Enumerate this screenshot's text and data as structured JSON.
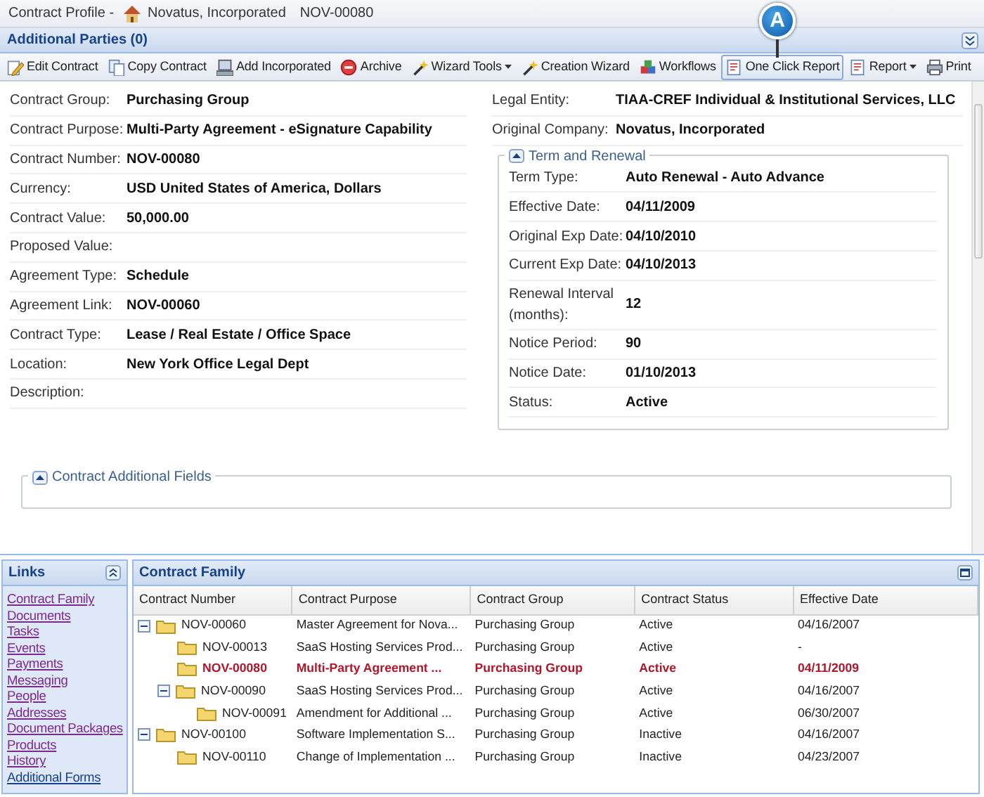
{
  "breadcrumb": {
    "prefix": "Contract Profile -",
    "company": "Novatus, Incorporated",
    "number": "NOV-00080"
  },
  "additional_parties": {
    "title": "Additional Parties (0)"
  },
  "callout": {
    "label": "A"
  },
  "toolbar": [
    {
      "label": "Edit Contract",
      "kind": "button",
      "pressed": false
    },
    {
      "label": "Copy Contract",
      "kind": "button",
      "pressed": false
    },
    {
      "label": "Add Incorporated",
      "kind": "button",
      "pressed": false
    },
    {
      "label": "Archive",
      "kind": "button",
      "pressed": false
    },
    {
      "label": "Wizard Tools",
      "kind": "dropdown",
      "pressed": false
    },
    {
      "label": "Creation Wizard",
      "kind": "button",
      "pressed": false
    },
    {
      "label": "Workflows",
      "kind": "button",
      "pressed": false
    },
    {
      "label": "One Click Report",
      "kind": "button",
      "pressed": true
    },
    {
      "label": "Report",
      "kind": "dropdown",
      "pressed": false
    },
    {
      "label": "Print",
      "kind": "button",
      "pressed": false
    }
  ],
  "left_fields": [
    {
      "label": "Contract Group:",
      "value": "Purchasing Group"
    },
    {
      "label": "Contract Purpose:",
      "value": "Multi-Party Agreement - eSignature Capability"
    },
    {
      "label": "Contract Number:",
      "value": "NOV-00080"
    },
    {
      "label": "Currency:",
      "value": "USD United States of America, Dollars"
    },
    {
      "label": "Contract Value:",
      "value": "50,000.00"
    },
    {
      "label": "Proposed Value:"
    },
    {
      "label": "Agreement Type:",
      "value": "Schedule"
    },
    {
      "label": "Agreement Link:",
      "value": "NOV-00060"
    },
    {
      "label": "Contract Type:",
      "value": "Lease / Real Estate / Office Space"
    },
    {
      "label": "Location:",
      "value": "New York Office Legal Dept"
    },
    {
      "label": "Description:"
    }
  ],
  "right_fields": [
    {
      "label": "Legal Entity:",
      "value": "TIAA-CREF Individual & Institutional Services, LLC"
    },
    {
      "label": "Original Company:",
      "value": "Novatus, Incorporated"
    }
  ],
  "term_and_renewal": {
    "title": "Term and Renewal",
    "fields": [
      {
        "label": "Term Type:",
        "value": "Auto Renewal - Auto Advance"
      },
      {
        "label": "Effective Date:",
        "value": "04/11/2009"
      },
      {
        "label": "Original Exp Date:",
        "value": "04/10/2010"
      },
      {
        "label": "Current Exp Date:",
        "value": "04/10/2013"
      },
      {
        "label": "Renewal Interval (months):",
        "value": "12"
      },
      {
        "label": "Notice Period:",
        "value": "90"
      },
      {
        "label": "Notice Date:",
        "value": "01/10/2013"
      },
      {
        "label": "Status:",
        "value": "Active"
      }
    ]
  },
  "additional_fields": {
    "title": "Contract Additional Fields"
  },
  "links": {
    "title": "Links",
    "items": [
      {
        "label": "Contract Family",
        "visited": true
      },
      {
        "label": "Documents",
        "visited": true
      },
      {
        "label": "Tasks",
        "visited": true
      },
      {
        "label": "Events",
        "visited": true
      },
      {
        "label": "Payments",
        "visited": true
      },
      {
        "label": "Messaging",
        "visited": true
      },
      {
        "label": "People",
        "visited": true
      },
      {
        "label": "Addresses",
        "visited": true
      },
      {
        "label": "Document Packages",
        "visited": true
      },
      {
        "label": "Products",
        "visited": true
      },
      {
        "label": "History",
        "visited": true
      },
      {
        "label": "Additional Forms",
        "visited": false
      }
    ]
  },
  "contract_family": {
    "title": "Contract Family",
    "columns": [
      "Contract Number",
      "Contract Purpose",
      "Contract Group",
      "Contract Status",
      "Effective Date"
    ],
    "rows": [
      {
        "cells": [
          "NOV-00060",
          "Master Agreement for Nova...",
          "Purchasing Group",
          "Active",
          "04/16/2007"
        ],
        "selected": false,
        "expanded": true,
        "children": [
          {
            "cells": [
              "NOV-00013",
              "SaaS Hosting Services Prod...",
              "Purchasing Group",
              "Active",
              "-"
            ],
            "selected": false
          },
          {
            "cells": [
              "NOV-00080",
              "Multi-Party Agreement ...",
              "Purchasing Group",
              "Active",
              "04/11/2009"
            ],
            "selected": true
          },
          {
            "cells": [
              "NOV-00090",
              "SaaS Hosting Services Prod...",
              "Purchasing Group",
              "Active",
              "04/16/2007"
            ],
            "selected": false,
            "expanded": true,
            "children": [
              {
                "cells": [
                  "NOV-00091",
                  "Amendment for Additional ...",
                  "Purchasing Group",
                  "Active",
                  "06/30/2007"
                ],
                "selected": false
              }
            ]
          }
        ]
      },
      {
        "cells": [
          "NOV-00100",
          "Software Implementation S...",
          "Purchasing Group",
          "Inactive",
          "04/16/2007"
        ],
        "selected": false,
        "expanded": true,
        "children": [
          {
            "cells": [
              "NOV-00110",
              "Change of Implementation ...",
              "Purchasing Group",
              "Inactive",
              "04/23/2007"
            ],
            "selected": false
          }
        ]
      }
    ]
  }
}
